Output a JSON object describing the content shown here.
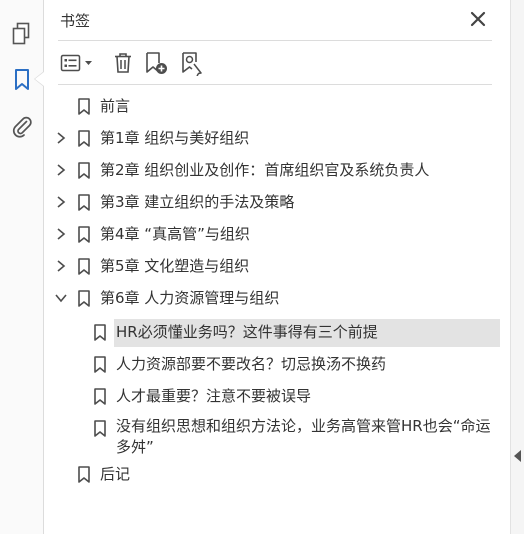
{
  "panel": {
    "title": "书签",
    "close_icon": "close-icon"
  },
  "rail": {
    "items": [
      {
        "name": "pages",
        "icon": "page-thumbnails-icon"
      },
      {
        "name": "bookmarks",
        "icon": "bookmark-icon",
        "active": true
      },
      {
        "name": "attachments",
        "icon": "paperclip-icon"
      }
    ]
  },
  "toolbar": {
    "buttons": [
      {
        "name": "options",
        "icon": "list-options-icon"
      },
      {
        "name": "delete",
        "icon": "trash-icon"
      },
      {
        "name": "new-bookmark",
        "icon": "add-bookmark-icon"
      },
      {
        "name": "find-bookmark",
        "icon": "bookmark-search-icon"
      }
    ]
  },
  "tree": {
    "items": [
      {
        "label": "前言",
        "level": 0,
        "expander": "none"
      },
      {
        "label": "第1章 组织与美好组织",
        "level": 0,
        "expander": "collapsed"
      },
      {
        "label": "第2章 组织创业及创作：首席组织官及系统负责人",
        "level": 0,
        "expander": "collapsed"
      },
      {
        "label": "第3章 建立组织的手法及策略",
        "level": 0,
        "expander": "collapsed"
      },
      {
        "label": "第4章 “真高管”与组织",
        "level": 0,
        "expander": "collapsed"
      },
      {
        "label": "第5章 文化塑造与组织",
        "level": 0,
        "expander": "collapsed"
      },
      {
        "label": "第6章 人力资源管理与组织",
        "level": 0,
        "expander": "expanded"
      },
      {
        "label": "HR必须懂业务吗？这件事得有三个前提",
        "level": 1,
        "expander": "none",
        "selected": true
      },
      {
        "label": "人力资源部要不要改名？切忌换汤不换药",
        "level": 1,
        "expander": "none"
      },
      {
        "label": "人才最重要？注意不要被误导",
        "level": 1,
        "expander": "none"
      },
      {
        "label": "没有组织思想和组织方法论，业务高管来管HR也会“命运多舛”",
        "level": 1,
        "expander": "none"
      },
      {
        "label": "后记",
        "level": 0,
        "expander": "none"
      }
    ]
  },
  "colors": {
    "accent": "#2b6fc4",
    "selection": "#e3e3e3",
    "icon": "#4d4d4d"
  }
}
